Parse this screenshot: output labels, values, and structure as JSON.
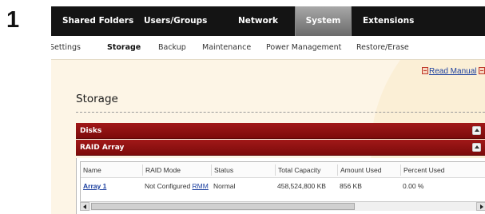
{
  "step_number": "1",
  "top_nav": {
    "items": [
      {
        "label": "Shared Folders"
      },
      {
        "label": "Users/Groups"
      },
      {
        "label": "Network"
      },
      {
        "label": "System",
        "active": true
      },
      {
        "label": "Extensions"
      }
    ]
  },
  "sub_nav": {
    "items": [
      {
        "label": "Settings"
      },
      {
        "label": "Storage",
        "active": true
      },
      {
        "label": "Backup"
      },
      {
        "label": "Maintenance"
      },
      {
        "label": "Power Management"
      },
      {
        "label": "Restore/Erase"
      }
    ]
  },
  "links": {
    "read_manual": "Read Manual"
  },
  "page": {
    "title": "Storage"
  },
  "panels": {
    "disks": {
      "title": "Disks"
    },
    "raid": {
      "title": "RAID Array"
    }
  },
  "raid_table": {
    "columns": [
      "Name",
      "RAID Mode",
      "Status",
      "Total Capacity",
      "Amount Used",
      "Percent Used"
    ],
    "rows": [
      {
        "name": "Array 1",
        "raid_mode": "Not Configured",
        "raid_mode_link": "RMM",
        "status": "Normal",
        "total_capacity": "458,524,800 KB",
        "amount_used": "856 KB",
        "percent_used": "0.00 %"
      }
    ]
  },
  "colors": {
    "top_nav_bg": "#141414",
    "panel_header": "#8e1010",
    "page_bg": "#fdf5e6",
    "link": "#1a3e9e"
  },
  "icons": [
    "print-manual-icon",
    "popup-icon",
    "collapse-up-icon",
    "scroll-left-icon",
    "scroll-right-icon"
  ]
}
